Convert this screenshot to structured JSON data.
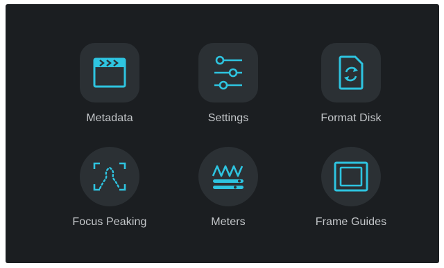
{
  "menu": {
    "items": [
      {
        "label": "Metadata",
        "icon": "clapperboard-icon",
        "shape": "square"
      },
      {
        "label": "Settings",
        "icon": "sliders-icon",
        "shape": "square"
      },
      {
        "label": "Format Disk",
        "icon": "format-disk-icon",
        "shape": "square"
      },
      {
        "label": "Focus Peaking",
        "icon": "focus-peaking-icon",
        "shape": "round"
      },
      {
        "label": "Meters",
        "icon": "meters-icon",
        "shape": "round"
      },
      {
        "label": "Frame Guides",
        "icon": "frame-guides-icon",
        "shape": "round"
      }
    ]
  },
  "colors": {
    "background": "#1b1e21",
    "tile": "#2b3034",
    "accent": "#2ec4e0",
    "label": "#c4c7ca"
  }
}
